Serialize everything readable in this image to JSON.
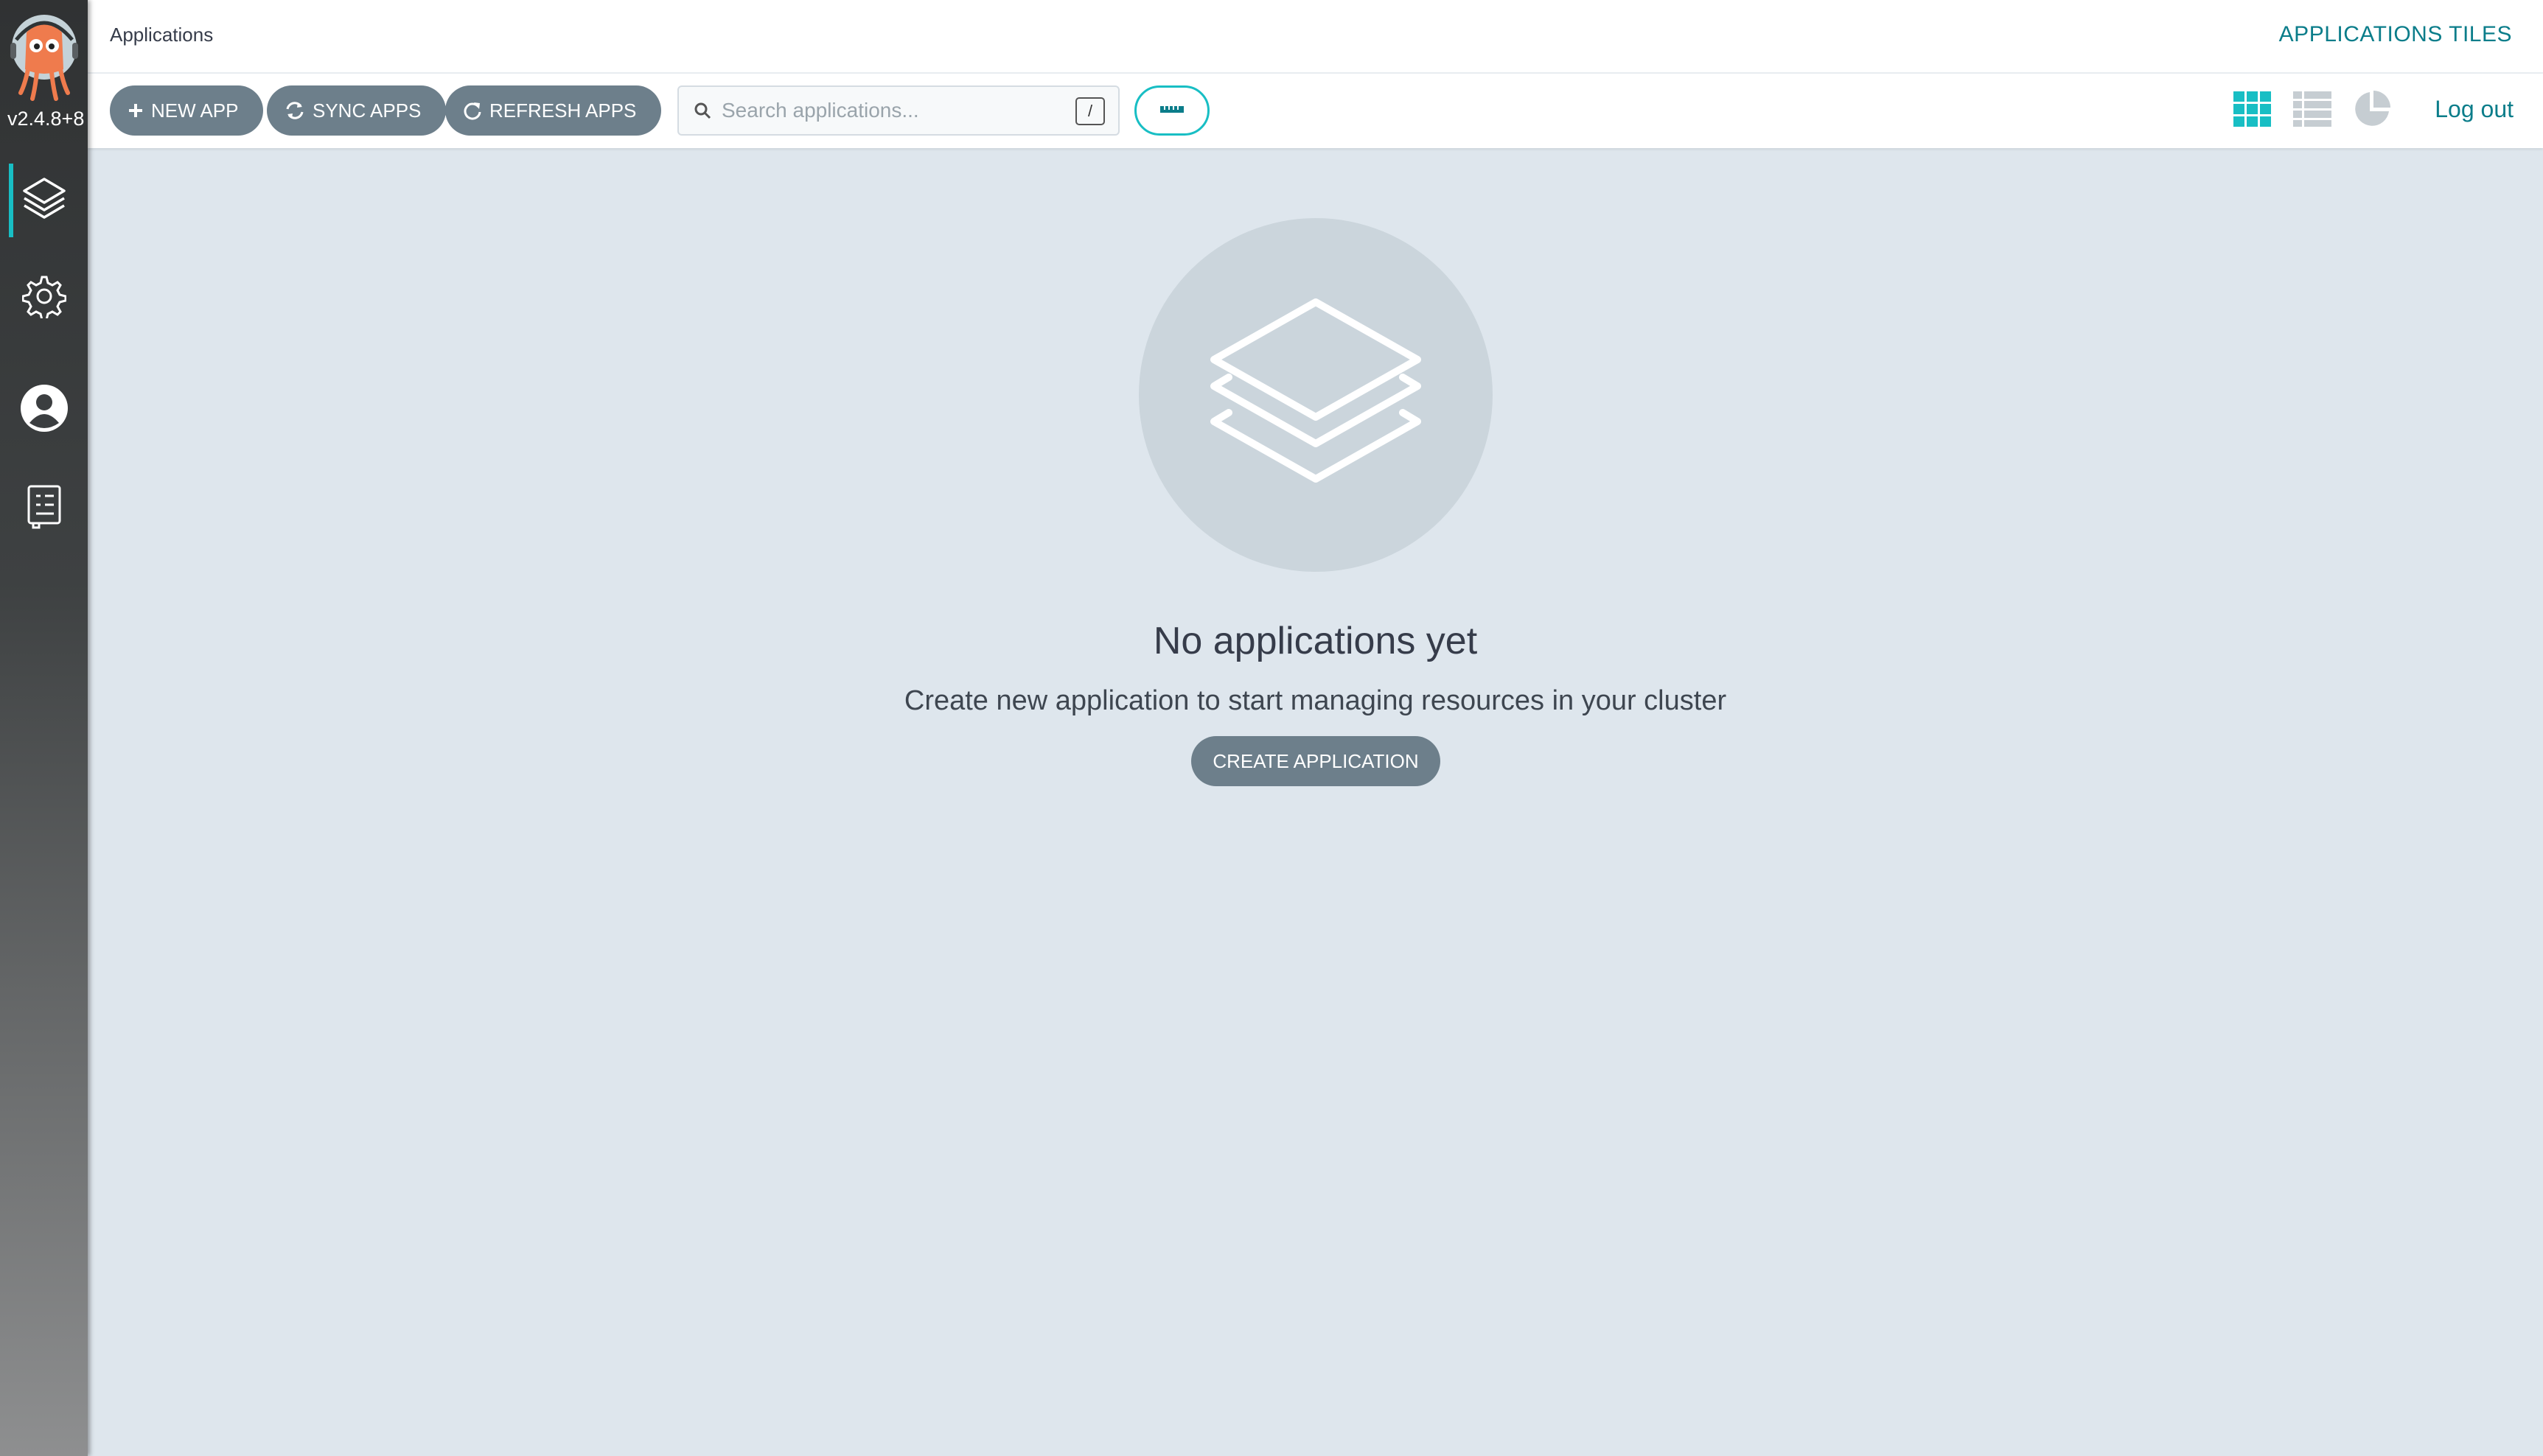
{
  "sidebar": {
    "version": "v2.4.8+8",
    "items": [
      {
        "icon": "layers-icon",
        "active": true
      },
      {
        "icon": "gear-icon",
        "active": false
      },
      {
        "icon": "user-icon",
        "active": false
      },
      {
        "icon": "docs-icon",
        "active": false
      }
    ]
  },
  "header": {
    "breadcrumb": "Applications",
    "title": "APPLICATIONS TILES"
  },
  "toolbar": {
    "new_app_label": "NEW APP",
    "sync_apps_label": "SYNC APPS",
    "refresh_apps_label": "REFRESH APPS",
    "search_placeholder": "Search applications...",
    "search_shortcut": "/",
    "logout_label": "Log out",
    "active_view": "tiles"
  },
  "empty_state": {
    "title": "No applications yet",
    "subtitle": "Create new application to start managing resources in your cluster",
    "button_label": "CREATE APPLICATION"
  },
  "colors": {
    "accent": "#18bec4",
    "link": "#0b7d8a",
    "button": "#6d7f8b",
    "background": "#dee6ed"
  }
}
